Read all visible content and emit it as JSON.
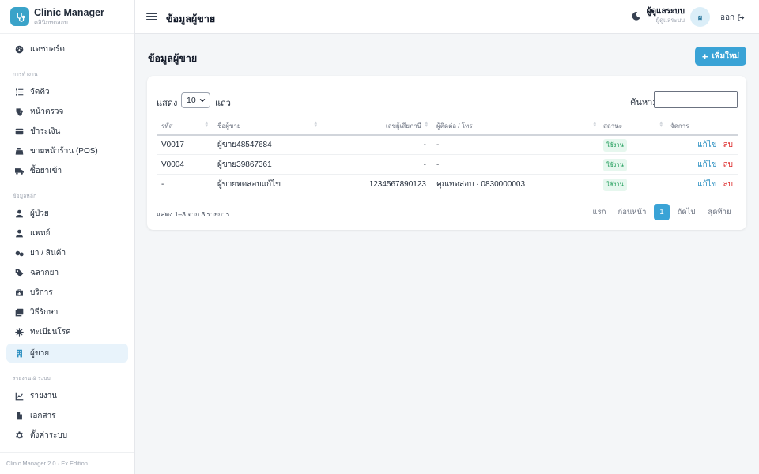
{
  "brand": {
    "title": "Clinic Manager",
    "subtitle": "คลินิกทดสอบ"
  },
  "sidebar": {
    "dashboard": "แดชบอร์ด",
    "section_operations": "การทำงาน",
    "queue": "จัดคิว",
    "examination": "หน้าตรวจ",
    "payment": "ชำระเงิน",
    "pos": "ขายหน้าร้าน (POS)",
    "purchase": "ซื้อยาเข้า",
    "section_master": "ข้อมูลหลัก",
    "patients": "ผู้ป่วย",
    "doctors": "แพทย์",
    "drugs": "ยา / สินค้า",
    "labels": "ฉลากยา",
    "services": "บริการ",
    "treatments": "วิธีรักษา",
    "diseases": "ทะเบียนโรค",
    "suppliers": "ผู้ขาย",
    "section_reports": "รายงาน & ระบบ",
    "reports": "รายงาน",
    "documents": "เอกสาร",
    "settings": "ตั้งค่าระบบ",
    "footer": "Clinic Manager 2.0 · Ex Edition"
  },
  "topbar": {
    "title": "ข้อมูลผู้ขาย",
    "user_name": "ผู้ดูแลระบบ",
    "user_role": "ผู้ดูแลระบบ",
    "avatar_initial": "ผ",
    "logout": "ออก"
  },
  "page": {
    "title": "ข้อมูลผู้ขาย",
    "add_button": "เพิ่มใหม่"
  },
  "table_controls": {
    "show_label": "แสดง",
    "page_size": "10",
    "rows_label": "แถว",
    "search_label": "ค้นหา:",
    "search_value": ""
  },
  "columns": [
    "รหัส",
    "ชื่อผู้ขาย",
    "เลขผู้เสียภาษี",
    "ผู้ติดต่อ / โทร",
    "สถานะ",
    "จัดการ"
  ],
  "rows": [
    {
      "code": "V0017",
      "name": "ผู้ขาย48547684",
      "tax_id": "-",
      "contact": "-",
      "status": "ใช้งาน"
    },
    {
      "code": "V0004",
      "name": "ผู้ขาย39867361",
      "tax_id": "-",
      "contact": "-",
      "status": "ใช้งาน"
    },
    {
      "code": "-",
      "name": "ผู้ขายทดสอบแก้ไข",
      "tax_id": "1234567890123",
      "contact": "คุณทดสอบ · 0830000003",
      "status": "ใช้งาน"
    }
  ],
  "actions": {
    "edit": "แก้ไข",
    "delete": "ลบ"
  },
  "footer_info": "แสดง 1–3 จาก 3 รายการ",
  "pagination": {
    "first": "แรก",
    "prev": "ก่อนหน้า",
    "current": "1",
    "next": "ถัดไป",
    "last": "สุดท้าย"
  },
  "colors": {
    "accent": "#3aa3d6",
    "active_bg": "#e8f3fb",
    "danger": "#dc2626",
    "success_bg": "#e6f7ee",
    "success_text": "#199a55"
  },
  "icons": {
    "brand": "stethoscope-icon",
    "dashboard": "gauge-icon",
    "queue": "list-ordered-icon",
    "examination": "stethoscope-icon",
    "payment": "credit-card-icon",
    "pos": "cash-register-icon",
    "purchase": "truck-icon",
    "patients": "user-icon",
    "doctors": "user-doctor-icon",
    "drugs": "pills-icon",
    "labels": "tag-icon",
    "services": "kit-icon",
    "treatments": "layers-icon",
    "diseases": "virus-icon",
    "suppliers": "building-icon",
    "reports": "chart-line-icon",
    "documents": "file-icon",
    "settings": "gear-icon",
    "menu": "hamburger-icon",
    "theme": "moon-icon",
    "logout": "logout-icon"
  }
}
